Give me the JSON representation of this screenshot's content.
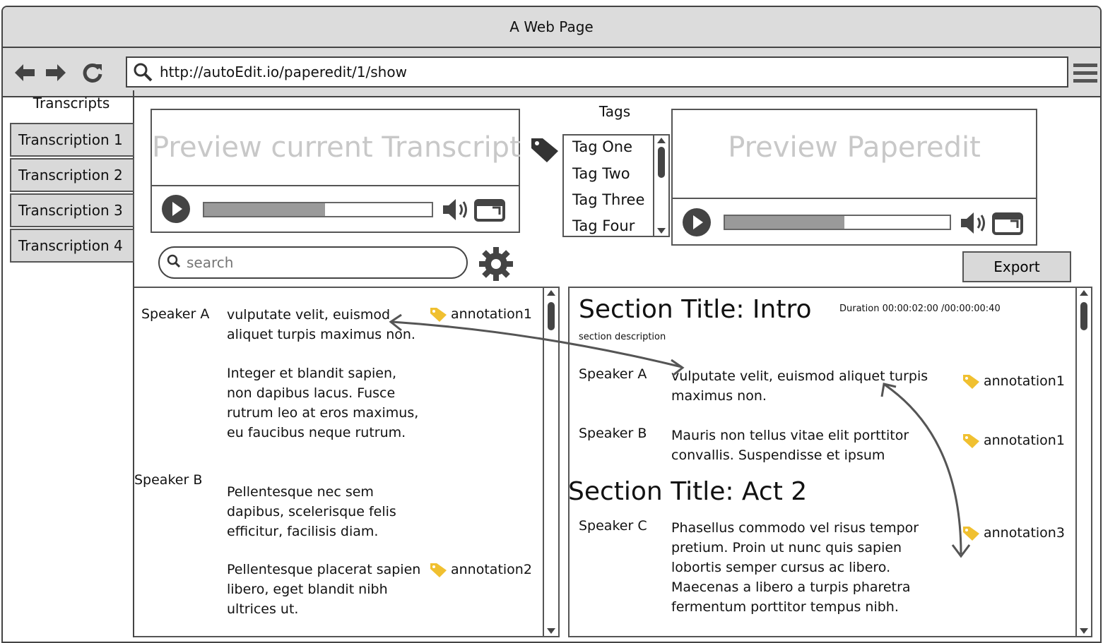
{
  "window": {
    "title": "A Web Page"
  },
  "browser": {
    "url": "http://autoEdit.io/paperedit/1/show"
  },
  "sidebar": {
    "title": "Transcripts",
    "items": [
      {
        "label": "Transcription 1"
      },
      {
        "label": "Transcription 2"
      },
      {
        "label": "Transcription 3"
      },
      {
        "label": "Transcription 4"
      }
    ]
  },
  "preview_transcript": {
    "placeholder": "Preview current Transcript",
    "progress": 0.53
  },
  "preview_paperedit": {
    "placeholder": "Preview Paperedit",
    "progress": 0.53
  },
  "tags": {
    "title": "Tags",
    "items": [
      "Tag One",
      "Tag Two",
      "Tag Three",
      "Tag Four"
    ]
  },
  "search": {
    "placeholder": "search"
  },
  "export_label": "Export",
  "transcript": {
    "rows": [
      {
        "speaker": "Speaker A",
        "text": "vulputate velit, euismod aliquet turpis maximus non.",
        "annotation": "annotation1"
      },
      {
        "speaker": "",
        "text": "Integer et blandit sapien, non dapibus lacus. Fusce rutrum leo at eros maximus, eu faucibus neque rutrum.",
        "annotation": ""
      },
      {
        "speaker": "Speaker B",
        "text": "Pellentesque nec sem dapibus, scelerisque felis efficitur, facilisis diam.",
        "annotation": ""
      },
      {
        "speaker": "",
        "text": "Pellentesque placerat sapien libero, eget blandit nibh ultrices ut.",
        "annotation": "annotation2"
      }
    ]
  },
  "paperedit": {
    "sections": [
      {
        "title": "Section Title: Intro",
        "duration": "Duration 00:00:02:00 /00:00:00:40",
        "description": "section description",
        "rows": [
          {
            "speaker": "Speaker A",
            "text": "vulputate velit, euismod aliquet turpis maximus non.",
            "annotation": "annotation1"
          },
          {
            "speaker": "Speaker B",
            "text": "Mauris non tellus vitae elit porttitor convallis. Suspendisse et ipsum",
            "annotation": "annotation1"
          }
        ]
      },
      {
        "title": "Section Title: Act 2",
        "rows": [
          {
            "speaker": "Speaker C",
            "text": "Phasellus commodo vel risus tempor pretium. Proin ut nunc quis sapien lobortis semper cursus ac libero. Maecenas a libero a turpis pharetra fermentum porttitor tempus nibh.",
            "annotation": "annotation3"
          }
        ]
      }
    ]
  },
  "colors": {
    "tag_icon": "#f0c030",
    "chrome": "#dcdcdc",
    "placeholder": "#c8c8c8"
  },
  "icons": [
    "back-arrow-icon",
    "forward-arrow-icon",
    "reload-icon",
    "search-icon",
    "menu-icon",
    "play-icon",
    "volume-icon",
    "fullscreen-icon",
    "tag-icon",
    "gear-icon"
  ]
}
